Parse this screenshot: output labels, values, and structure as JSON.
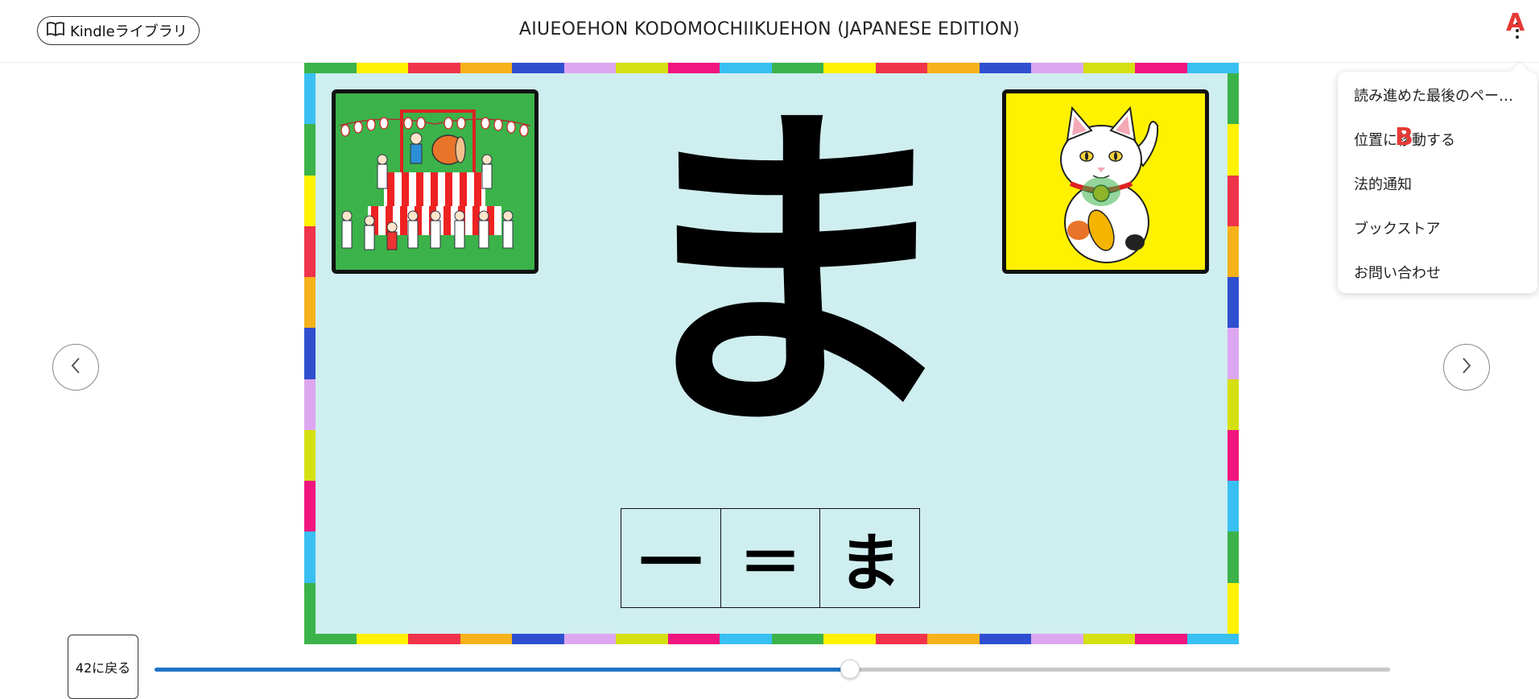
{
  "header": {
    "library_button_label": "Kindleライブラリ",
    "book_title": "AIUEOEHON KODOMOCHIIKUEHON (JAPANESE EDITION)"
  },
  "annotations": {
    "marker_a": "A",
    "marker_b": "B"
  },
  "menu": {
    "items": [
      {
        "label": "読み進めた最後のペー…"
      },
      {
        "label": "位置に移動する"
      },
      {
        "label": "法的通知"
      },
      {
        "label": "ブックストア"
      },
      {
        "label": "お問い合わせ"
      }
    ]
  },
  "page": {
    "big_character": "ま",
    "stroke_steps": [
      "一",
      "＝",
      "ま"
    ],
    "colors": {
      "background": "#cfeef0",
      "festival_panel_bg": "#3bb34a",
      "cat_panel_bg": "#fff200",
      "border_palette": [
        "#3bb34a",
        "#fff200",
        "#f0334b",
        "#f7b21b",
        "#2f4fd0",
        "#dca7f0",
        "#d5e012",
        "#f0157f",
        "#38c0f2"
      ]
    }
  },
  "footer": {
    "back_button_label": "42に戻る",
    "progress_fraction": 0.562
  },
  "icons": {
    "library": "book-open-icon",
    "more": "more-vertical-icon",
    "prev": "chevron-left-icon",
    "next": "chevron-right-icon"
  }
}
